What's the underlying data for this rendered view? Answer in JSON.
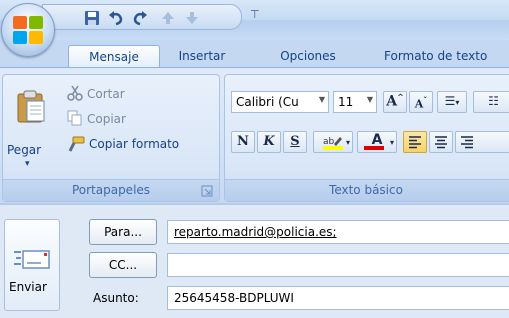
{
  "qat": {
    "separator_label": "⊤"
  },
  "tabs": [
    {
      "label": "Mensaje",
      "active": true
    },
    {
      "label": "Insertar",
      "active": false
    },
    {
      "label": "Opciones",
      "active": false
    },
    {
      "label": "Formato de texto",
      "active": false
    }
  ],
  "ribbon": {
    "clipboard": {
      "label": "Portapapeles",
      "paste": "Pegar",
      "cut": "Cortar",
      "copy": "Copiar",
      "format_painter": "Copiar formato"
    },
    "basic_text": {
      "label": "Texto básico",
      "font_name": "Calibri (Cu",
      "font_size": "11",
      "bold": "N",
      "italic": "K",
      "underline": "S"
    }
  },
  "message": {
    "send": "Enviar",
    "to_button": "Para...",
    "cc_button": "CC...",
    "subject_label": "Asunto:",
    "to_value": "reparto.madrid@policia.es;",
    "cc_value": "",
    "subject_value": "25645458-BDPLUWI"
  },
  "colors": {
    "accent": "#15428b",
    "ribbon_bg": "#d2e2f6",
    "highlight": "#f8d36a"
  }
}
